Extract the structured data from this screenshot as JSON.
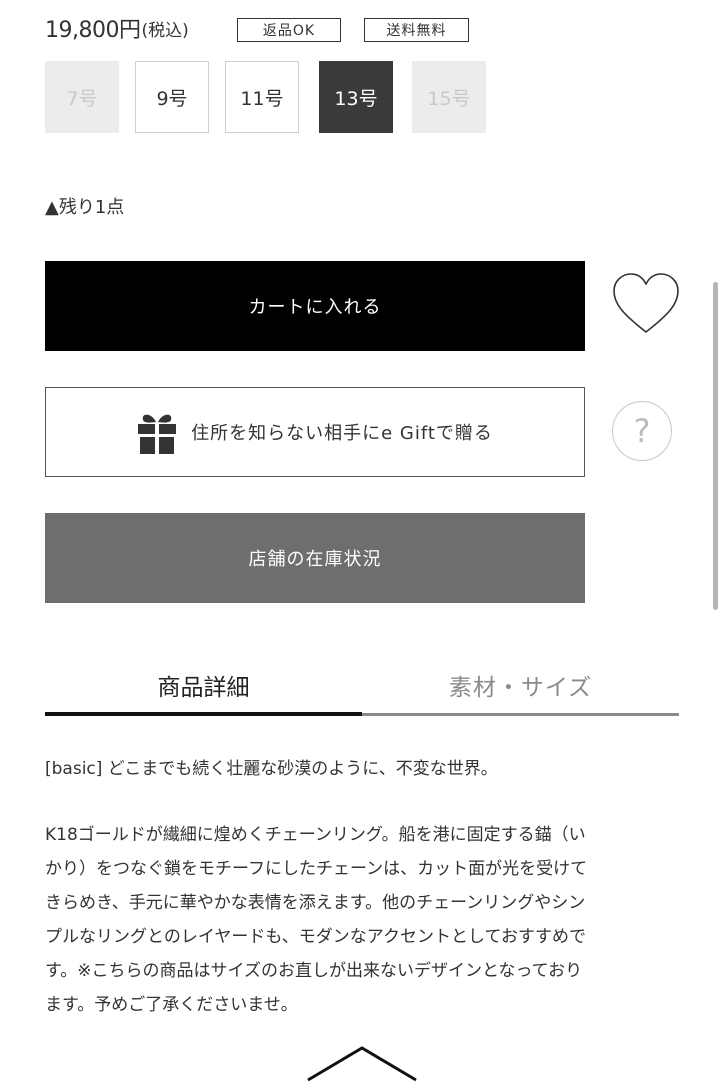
{
  "price": {
    "amount": "19,800円",
    "tax_note": "(税込)"
  },
  "tags": {
    "returns": "返品OK",
    "shipping": "送料無料"
  },
  "sizes": [
    {
      "label": "7号",
      "state": "disabled"
    },
    {
      "label": "9号",
      "state": "available"
    },
    {
      "label": "11号",
      "state": "available"
    },
    {
      "label": "13号",
      "state": "selected"
    },
    {
      "label": "15号",
      "state": "disabled"
    }
  ],
  "stock_text": "▲残り1点",
  "buttons": {
    "cart": "カートに入れる",
    "gift": "住所を知らない相手にe Giftで贈る",
    "store_stock": "店舗の在庫状況"
  },
  "icons": {
    "favorite": "heart-icon",
    "help": "question-icon",
    "gift": "gift-icon",
    "collapse": "chevron-up-icon"
  },
  "help_glyph": "?",
  "tabs": {
    "details": "商品詳細",
    "material": "素材・サイズ"
  },
  "description": {
    "intro": "[basic] どこまでも続く壮麗な砂漠のように、不変な世界。",
    "lines": [
      "K18ゴールドが繊細に煌めくチェーンリング。船を港に固定する錨（い",
      "かり）をつなぐ鎖をモチーフにしたチェーンは、カット面が光を受けて",
      "きらめき、手元に華やかな表情を添えます。他のチェーンリングやシン",
      "プルなリングとのレイヤードも、モダンなアクセントとしておすすめで",
      "す。※こちらの商品はサイズのお直しが出来ないデザインとなっており",
      "ます。予めご了承くださいませ。"
    ]
  },
  "colors": {
    "cart_bg": "#000000",
    "store_bg": "#6e6e6e",
    "selected_size": "#3a3a3a",
    "disabled_size": "#ececec"
  }
}
